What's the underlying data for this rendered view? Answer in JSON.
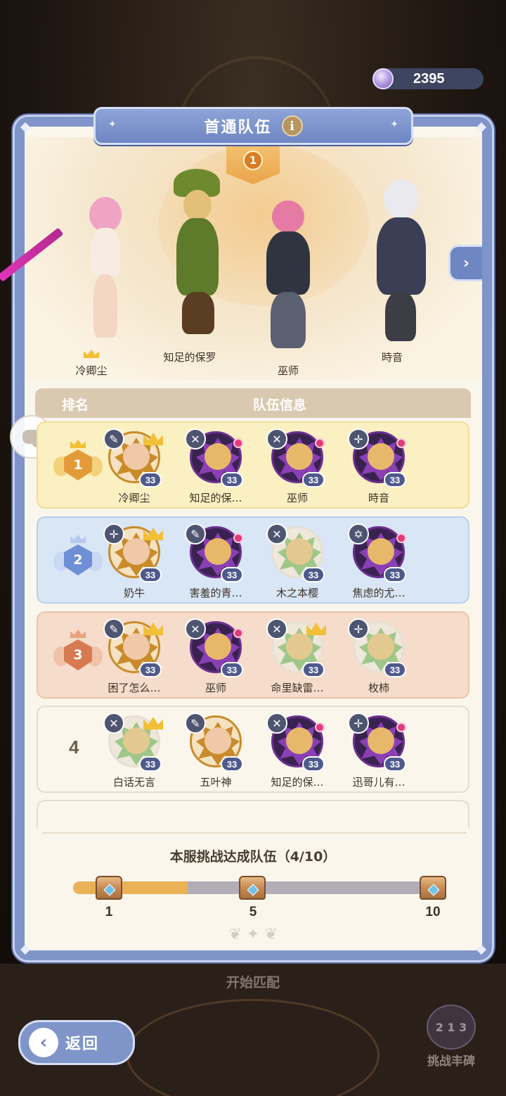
{
  "currency": {
    "amount": "2395",
    "icon": "crystal-gem-icon"
  },
  "header": {
    "title": "首通队伍",
    "info_icon": "i"
  },
  "showcase": {
    "rank_number": "1",
    "heroes": [
      {
        "name": "冷卿尘",
        "leader": true
      },
      {
        "name": "知足的保罗"
      },
      {
        "name": "巫师"
      },
      {
        "name": "時音"
      }
    ],
    "next_icon": "chevron-right-icon"
  },
  "table": {
    "headers": {
      "rank": "排名",
      "team": "队伍信息"
    },
    "rows": [
      {
        "rank": "1",
        "tier": "gold",
        "members": [
          {
            "name": "冷卿尘",
            "level": "33",
            "weapon": "✎",
            "crown": true,
            "frame": "gold"
          },
          {
            "name": "知足的保…",
            "level": "33",
            "weapon": "✕",
            "crown": false,
            "frame": "purple"
          },
          {
            "name": "巫师",
            "level": "33",
            "weapon": "✕",
            "crown": false,
            "frame": "purple"
          },
          {
            "name": "時音",
            "level": "33",
            "weapon": "✛",
            "crown": false,
            "frame": "purple"
          }
        ]
      },
      {
        "rank": "2",
        "tier": "silver",
        "members": [
          {
            "name": "奶牛",
            "level": "33",
            "weapon": "✛",
            "crown": true,
            "frame": "gold"
          },
          {
            "name": "害羞的青…",
            "level": "33",
            "weapon": "✎",
            "crown": false,
            "frame": "purple"
          },
          {
            "name": "木之本樱",
            "level": "33",
            "weapon": "✕",
            "crown": false,
            "frame": "plain"
          },
          {
            "name": "焦虑的尤…",
            "level": "33",
            "weapon": "✡",
            "crown": false,
            "frame": "purple"
          }
        ]
      },
      {
        "rank": "3",
        "tier": "bronze",
        "members": [
          {
            "name": "困了怎么…",
            "level": "33",
            "weapon": "✎",
            "crown": true,
            "frame": "gold"
          },
          {
            "name": "巫师",
            "level": "33",
            "weapon": "✕",
            "crown": false,
            "frame": "purple"
          },
          {
            "name": "命里缺雷…",
            "level": "33",
            "weapon": "✕",
            "crown": true,
            "frame": "plain"
          },
          {
            "name": "枚柿",
            "level": "33",
            "weapon": "✛",
            "crown": false,
            "frame": "plain"
          }
        ]
      },
      {
        "rank": "4",
        "tier": "plain",
        "members": [
          {
            "name": "白话无言",
            "level": "33",
            "weapon": "✕",
            "crown": true,
            "frame": "plain"
          },
          {
            "name": "五叶神",
            "level": "33",
            "weapon": "✎",
            "crown": false,
            "frame": "gold"
          },
          {
            "name": "知足的保…",
            "level": "33",
            "weapon": "✕",
            "crown": false,
            "frame": "purple"
          },
          {
            "name": "迅哥儿有…",
            "level": "33",
            "weapon": "✛",
            "crown": false,
            "frame": "purple"
          }
        ]
      }
    ]
  },
  "progress": {
    "title": "本服挑战达成队伍（4/10）",
    "current": 4,
    "max": 10,
    "milestones": [
      "1",
      "5",
      "10"
    ]
  },
  "footer": {
    "start_match": "开始匹配",
    "back_label": "返回",
    "monument_label": "挑战丰碑",
    "monument_icon": "2 1 3"
  },
  "colors": {
    "panel": "#7f95c9",
    "gold_row": "#fbf0c2",
    "silver_row": "#d8e6f6",
    "bronze_row": "#f5dccb",
    "progress_fill": "#eab156"
  }
}
